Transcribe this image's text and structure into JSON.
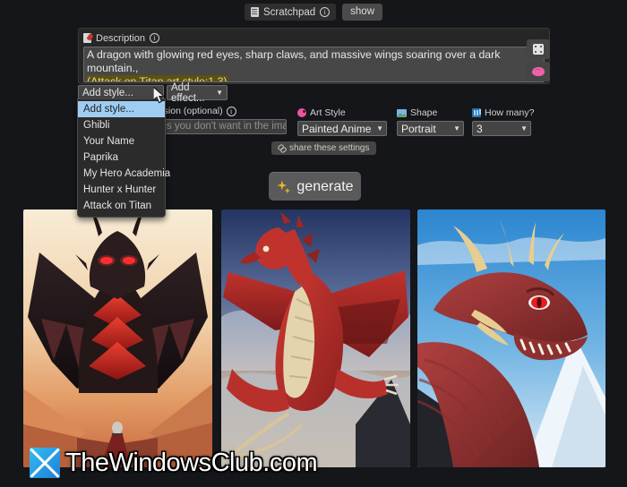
{
  "scratchpad": {
    "label": "Scratchpad",
    "note_icon": "note-icon",
    "info_icon": "info-icon",
    "show_label": "show"
  },
  "description": {
    "label": "Description",
    "pen_icon": "pen-icon",
    "info_icon": "info-icon",
    "line1": "A dragon with glowing red eyes, sharp claws, and massive wings soaring over a dark mountain.,",
    "line2": "(Attack on Titan art style:1.3)",
    "highlight_color": "#5b5212",
    "highlight_text_color": "#e3d98a",
    "dice_button_icon": "dice-icon",
    "brain_button_icon": "brain-icon"
  },
  "style_controls": {
    "add_style_value": "Add style...",
    "add_effect_value": "Add effect..."
  },
  "style_dropdown": {
    "open": true,
    "selected_index": 0,
    "items": [
      "Add style...",
      "Ghibli",
      "Your Name",
      "Paprika",
      "My Hero Academia",
      "Hunter x Hunter",
      "Attack on Titan"
    ],
    "highlight_color": "#9fcdf2"
  },
  "exclusion": {
    "label": "Exclusion (optional)",
    "info_icon": "info-icon",
    "value": "",
    "placeholder": "things you don't want in the image"
  },
  "fields": [
    {
      "label": "Art Style",
      "icon": "palette-icon",
      "value": "Painted Anime"
    },
    {
      "label": "Shape",
      "icon": "image-shape-icon",
      "value": "Portrait"
    },
    {
      "label": "How many?",
      "icon": "bars-icon",
      "value": "3"
    }
  ],
  "share": {
    "label": "share these settings",
    "icon": "link-icon"
  },
  "generate": {
    "label": "generate",
    "icon": "sparkles-icon"
  },
  "results": [
    {
      "alt": "Dark winged dragon with glowing red eyes facing viewer over a sunset canyon with a small human figure below",
      "sky_top": "#f6e3c8",
      "sky_bottom": "#e79a63",
      "body": "#2a1c1d",
      "accent": "#cf2020"
    },
    {
      "alt": "Red muscular dragon standing on hind legs with cream belly against a blue cloudy sky",
      "sky_top": "#2d3f6b",
      "sky_bottom": "#d8b58e",
      "body": "#a82c28",
      "accent": "#e7d9b4"
    },
    {
      "alt": "Close-up profile of a red dragon head with golden horns against a bright blue sky and snowy mountains",
      "sky_top": "#2f86cf",
      "sky_bottom": "#cfe6f5",
      "body": "#9a3030",
      "accent": "#e2c98d"
    }
  ],
  "watermark": {
    "text": "TheWindowsClub.com",
    "logo_icon": "x-logo-icon"
  },
  "theme": {
    "background": "#141619",
    "panel": "#262626",
    "control": "#454545"
  }
}
